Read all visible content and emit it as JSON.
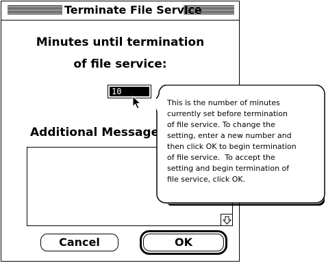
{
  "window": {
    "title": "Terminate File Service"
  },
  "dialog": {
    "heading_line1": "Minutes until termination",
    "heading_line2": "of file service:",
    "minutes_value": "10",
    "additional_message_label": "Additional Message",
    "message_text": "",
    "cancel_label": "Cancel",
    "ok_label": "OK"
  },
  "help_balloon": {
    "text": "This is the number of minutes\ncurrently set before termination\nof file service. To change the\nsetting, enter a new number and\nthen click OK to begin termination\nof file service.  To accept the\nsetting and begin termination of\nfile service, click OK."
  },
  "icons": {
    "pointer": "arrow-cursor-icon",
    "scroll_down": "scroll-down-arrow-icon"
  }
}
